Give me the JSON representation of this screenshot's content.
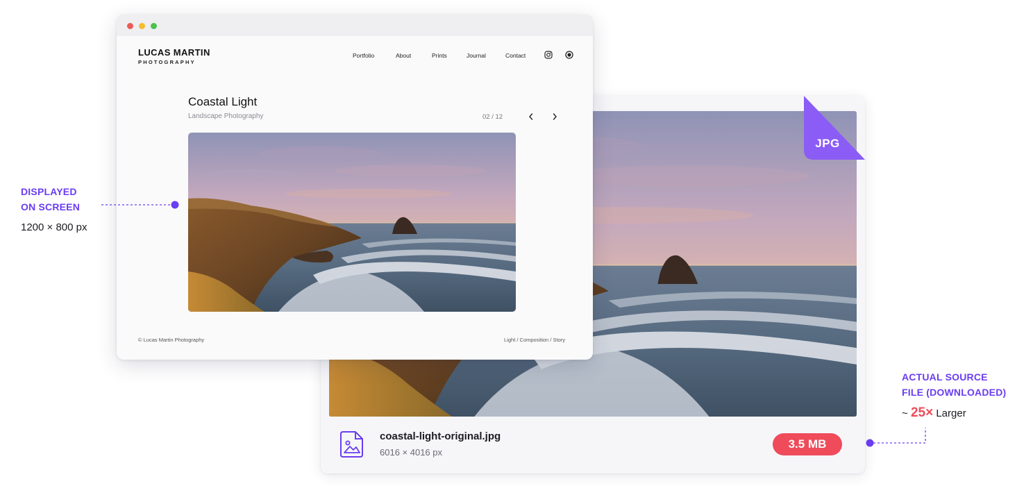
{
  "colors": {
    "accent_purple": "#6a3df0",
    "badge_red": "#ef4b5a",
    "jpg_corner": "#8b5cf6"
  },
  "browser": {
    "window_controls": [
      "close",
      "minimize",
      "maximize"
    ],
    "brand": {
      "name": "LUCAS MARTIN",
      "subtitle": "PHOTOGRAPHY"
    },
    "nav": [
      {
        "label": "Portfolio"
      },
      {
        "label": "About"
      },
      {
        "label": "Prints"
      },
      {
        "label": "Journal"
      },
      {
        "label": "Contact"
      }
    ],
    "nav_icons": [
      "instagram-icon",
      "target-icon"
    ],
    "gallery": {
      "title": "Coastal Light",
      "subtitle": "Landscape Photography",
      "pager": "02 / 12"
    },
    "footer": {
      "copyright": "© Lucas Martin Photography",
      "tagline": "Light / Composition / Story"
    }
  },
  "file_card": {
    "format": "JPG",
    "filename": "coastal-light-original.jpg",
    "dimensions": "6016 × 4016 px",
    "size": "3.5 MB"
  },
  "annotations": {
    "displayed": {
      "line1": "DISPLAYED",
      "line2": "ON SCREEN",
      "dimensions": "1200 × 800 px"
    },
    "source": {
      "line1": "ACTUAL SOURCE",
      "line2": "FILE (DOWNLOADED)",
      "prefix": "~",
      "multiplier": "25×",
      "suffix": "Larger"
    }
  }
}
